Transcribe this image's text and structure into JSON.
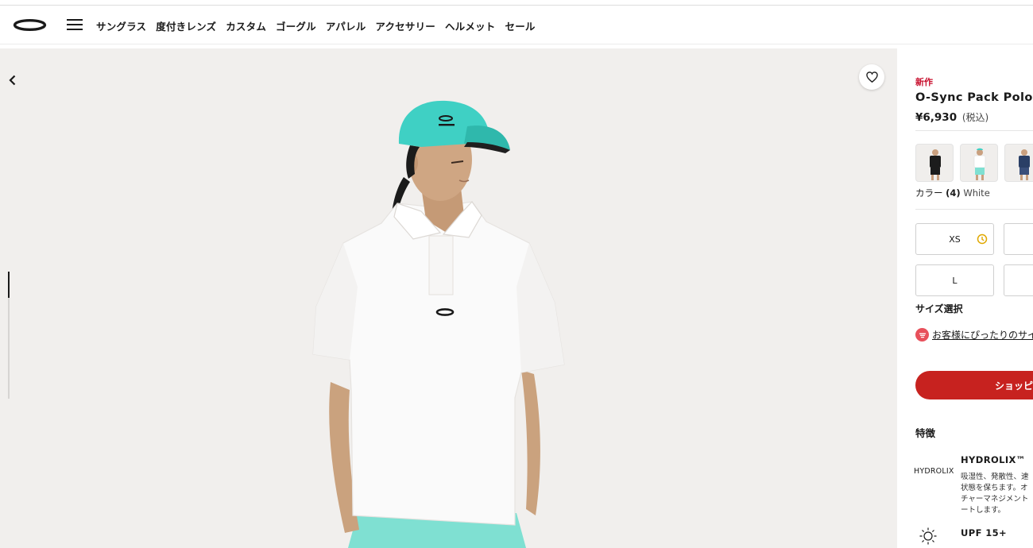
{
  "header": {
    "nav": [
      "サングラス",
      "度付きレンズ",
      "カスタム",
      "ゴーグル",
      "アパレル",
      "アクセサリー",
      "ヘルメット",
      "セール"
    ]
  },
  "product": {
    "tag": "新作",
    "title": "O-Sync Pack Polo C",
    "price": "¥6,930",
    "tax": "(税込)",
    "color_label": "カラー",
    "color_count": "(4)",
    "color_value": "White",
    "sizes": [
      "XS",
      "",
      "L",
      ""
    ],
    "size_select": "サイズ選択",
    "fit_link": "お客様にぴったりのサイ",
    "shop_button": "ショッピン",
    "features_title": "特徴",
    "features": [
      {
        "logo": "HYDROLIX",
        "name": "HYDROLIX™",
        "desc": [
          "吸湿性、発散性、速",
          "状態を保ちます。オ",
          "チャーマネジメント",
          "ートします。"
        ]
      },
      {
        "name": "UPF 15+"
      }
    ]
  },
  "colors": {
    "accent_red": "#c7221f",
    "new_tag": "#c8102e",
    "hat_teal": "#3fd0c4",
    "shorts_mint": "#7fe0d2",
    "low_stock_icon": "#e0a800"
  },
  "icons": {
    "back": "chevron-left-icon",
    "wishlist": "heart-icon",
    "menu": "hamburger-icon",
    "low_stock": "clock-icon",
    "fit": "fit-advisor-icon",
    "upf": "sun-icon"
  }
}
